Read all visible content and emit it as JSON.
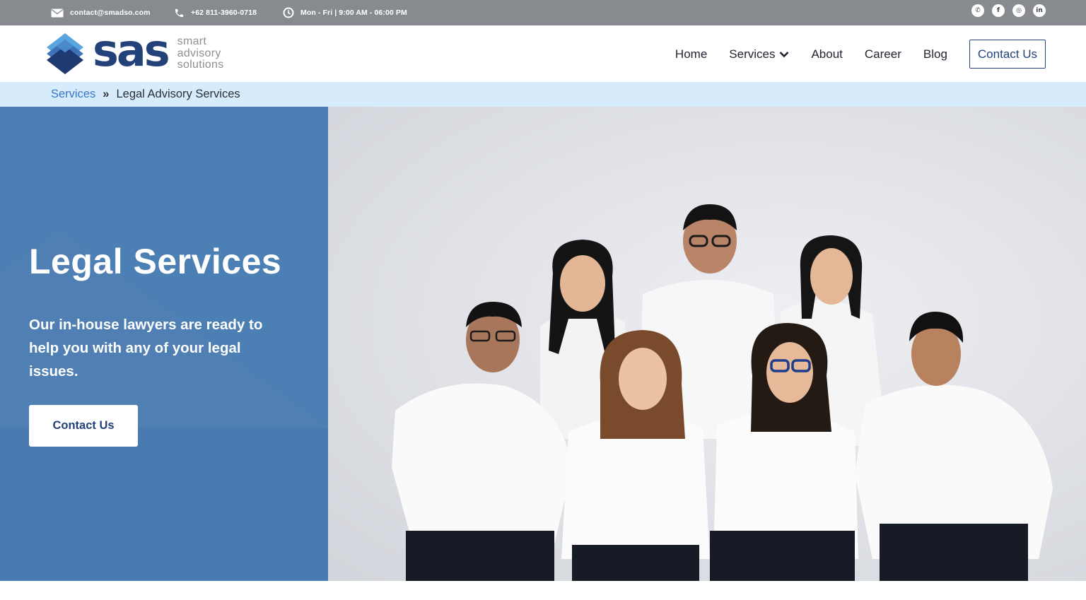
{
  "topbar": {
    "email": "contact@smadso.com",
    "phone": "+62 811-3960-0718",
    "hours": "Mon - Fri | 9:00 AM - 06:00 PM",
    "socials": [
      {
        "name": "whatsapp-icon",
        "glyph": "✆"
      },
      {
        "name": "facebook-icon",
        "glyph": "f"
      },
      {
        "name": "instagram-icon",
        "glyph": "◎"
      },
      {
        "name": "linkedin-icon",
        "glyph": "in"
      }
    ]
  },
  "logo": {
    "wordmark": "sas",
    "tagline": [
      "smart",
      "advisory",
      "solutions"
    ]
  },
  "nav": {
    "home": "Home",
    "services": "Services",
    "about": "About",
    "career": "Career",
    "blog": "Blog",
    "contact": "Contact Us"
  },
  "breadcrumb": {
    "parent": "Services",
    "separator": "»",
    "current": "Legal Advisory Services"
  },
  "hero": {
    "title": "Legal Services",
    "description": "Our in-house lawyers are ready to help you with any of your legal issues.",
    "button": "Contact Us"
  },
  "colors": {
    "topbar": "#878b8f",
    "brand_navy": "#24427a",
    "breadcrumb_bg": "#d6ebfb",
    "hero_blue": "#4c7fb3",
    "link_blue": "#3a77c4"
  }
}
